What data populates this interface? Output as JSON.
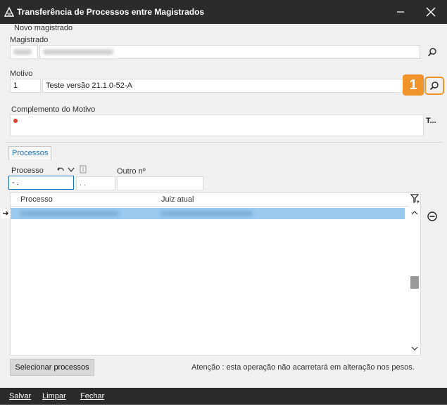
{
  "window": {
    "title": "Transferência de Processos entre Magistrados"
  },
  "novo_magistrado": {
    "group_label": "Novo magistrado",
    "magistrado_label": "Magistrado"
  },
  "motivo": {
    "label": "Motivo",
    "code": "1",
    "description": "Teste versão 21.1.0-52-A"
  },
  "complemento": {
    "label": "Complemento do Motivo",
    "side_button": "T..."
  },
  "callout": {
    "number": "1",
    "color": "#f0932b"
  },
  "processos_tab": {
    "label": "Processos"
  },
  "filters": {
    "processo_label": "Processo",
    "processo_value": " - .",
    "secondary_value": ". .",
    "outro_label": "Outro nº"
  },
  "grid": {
    "columns": [
      "Processo",
      "Juiz atual"
    ],
    "selected_row_color": "#99c9ef"
  },
  "actions": {
    "select_button": "Selecionar processos",
    "note": "Atenção : esta operação não acarretará em alteração nos pesos."
  },
  "footer": {
    "save": "Salvar",
    "clear": "Limpar",
    "close": "Fechar"
  },
  "colors": {
    "titlebar": "#2b2b2b",
    "accent": "#1a6fb5",
    "required_dot": "#e53935"
  }
}
